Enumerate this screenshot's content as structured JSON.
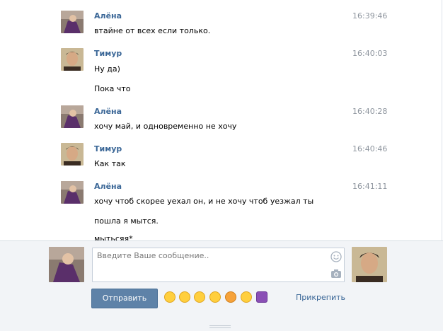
{
  "messages": [
    {
      "author": "Алёна",
      "time": "16:39:46",
      "lines": [
        "втайне от всех если только."
      ]
    },
    {
      "author": "Тимур",
      "time": "16:40:03",
      "lines": [
        "Ну да)",
        "Пока что"
      ]
    },
    {
      "author": "Алёна",
      "time": "16:40:28",
      "lines": [
        "хочу май, и одновременно не хочу"
      ]
    },
    {
      "author": "Тимур",
      "time": "16:40:46",
      "lines": [
        "Как так"
      ]
    },
    {
      "author": "Алёна",
      "time": "16:41:11",
      "lines": [
        "хочу чтоб скорее уехал он, и не хочу чтоб уезжал ты",
        "пошла я мытся.",
        "мытьсяя*"
      ]
    }
  ],
  "composer": {
    "placeholder": "Введите Ваше сообщение..",
    "send_label": "Отправить",
    "attach_label": "Прикрепить",
    "emojis": [
      "big-grin-icon",
      "smile-icon",
      "neutral-icon",
      "grimace-icon",
      "angry-icon",
      "kiss-icon",
      "devil-icon"
    ],
    "emoji_colors": [
      "#ffcf3e",
      "#ffcf3e",
      "#ffcf3e",
      "#ffcf3e",
      "#f6a23a",
      "#ffcf3e",
      "#8a4fb5"
    ]
  },
  "colors": {
    "author": "#3b6797",
    "time": "#8e959e",
    "send_button": "#5e82a8",
    "composer_bg": "#f2f4f7"
  }
}
